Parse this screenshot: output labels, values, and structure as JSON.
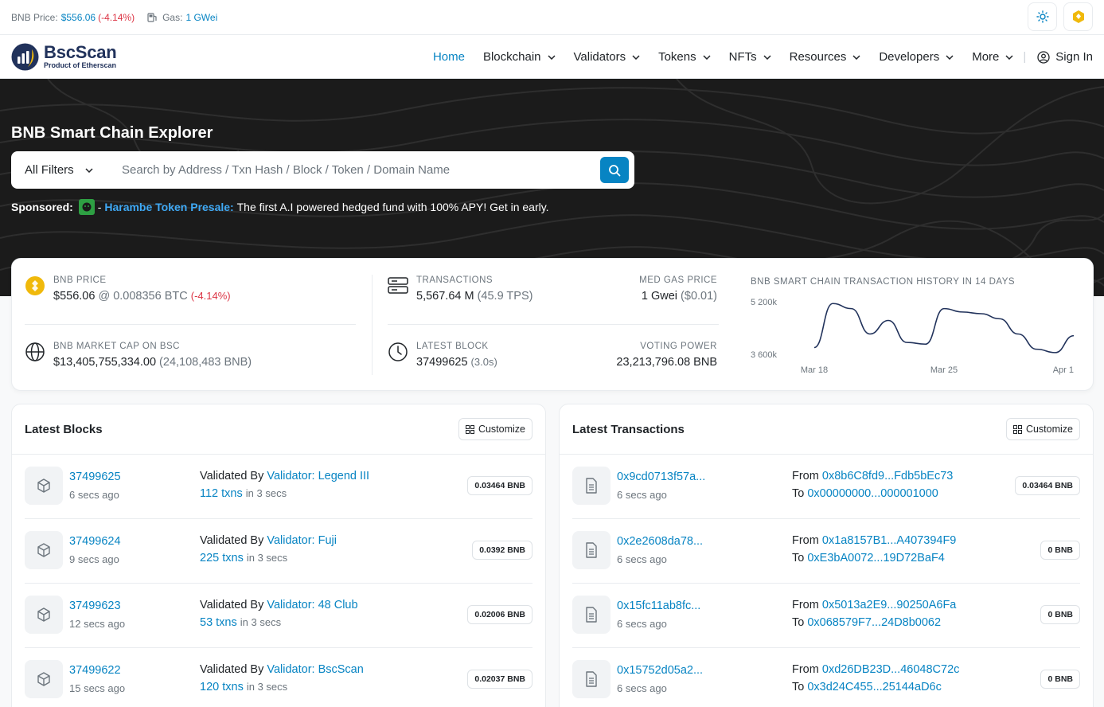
{
  "topbar": {
    "bnb_price_label": "BNB Price:",
    "bnb_price_value": "$556.06",
    "bnb_price_change": "(-4.14%)",
    "gas_label": "Gas:",
    "gas_value": "1 GWei"
  },
  "nav": {
    "logo_title": "BscScan",
    "logo_subtitle": "Product of Etherscan",
    "items": [
      "Home",
      "Blockchain",
      "Validators",
      "Tokens",
      "NFTs",
      "Resources",
      "Developers",
      "More"
    ],
    "signin": "Sign In"
  },
  "hero": {
    "title": "BNB Smart Chain Explorer",
    "filter": "All Filters",
    "search_placeholder": "Search by Address / Txn Hash / Block / Token / Domain Name",
    "sponsored_label": "Sponsored:",
    "sponsored_dash": "-",
    "sponsored_link": "Harambe Token Presale:",
    "sponsored_text": "The first A.I powered hedged fund with 100% APY! Get in early."
  },
  "stats": {
    "bnb_price_label": "BNB PRICE",
    "bnb_price": "$556.06",
    "bnb_price_btc": "@ 0.008356 BTC",
    "bnb_price_change": "(-4.14%)",
    "market_cap_label": "BNB MARKET CAP ON BSC",
    "market_cap": "$13,405,755,334.00",
    "market_cap_bnb": "(24,108,483 BNB)",
    "transactions_label": "TRANSACTIONS",
    "transactions": "5,567.64 M",
    "tps": "(45.9 TPS)",
    "gas_label": "MED GAS PRICE",
    "gas": "1 Gwei",
    "gas_usd": "($0.01)",
    "latest_block_label": "LATEST BLOCK",
    "latest_block": "37499625",
    "block_time": "(3.0s)",
    "voting_power_label": "VOTING POWER",
    "voting_power": "23,213,796.08 BNB"
  },
  "chart_data": {
    "type": "line",
    "title": "BNB SMART CHAIN TRANSACTION HISTORY IN 14 DAYS",
    "x": [
      "Mar 18",
      "Mar 19",
      "Mar 20",
      "Mar 21",
      "Mar 22",
      "Mar 23",
      "Mar 24",
      "Mar 25",
      "Mar 26",
      "Mar 27",
      "Mar 28",
      "Mar 29",
      "Mar 30",
      "Mar 31",
      "Apr 1"
    ],
    "values": [
      3800,
      5100,
      4950,
      4200,
      4600,
      3950,
      3900,
      4950,
      4850,
      4800,
      4650,
      4200,
      3750,
      3650,
      4150
    ],
    "x_tick_labels": [
      "Mar 18",
      "Mar 25",
      "Apr 1"
    ],
    "y_tick_labels": [
      "5 200k",
      "3 600k"
    ],
    "ylim": [
      3600,
      5200
    ]
  },
  "blocks": {
    "title": "Latest Blocks",
    "customize": "Customize",
    "rows": [
      {
        "id": "37499625",
        "time": "6 secs ago",
        "validated_by": "Validated By",
        "validator": "Validator: Legend III",
        "txns": "112 txns",
        "txns_suffix": "in 3 secs",
        "reward": "0.03464 BNB"
      },
      {
        "id": "37499624",
        "time": "9 secs ago",
        "validated_by": "Validated By",
        "validator": "Validator: Fuji",
        "txns": "225 txns",
        "txns_suffix": "in 3 secs",
        "reward": "0.0392 BNB"
      },
      {
        "id": "37499623",
        "time": "12 secs ago",
        "validated_by": "Validated By",
        "validator": "Validator: 48 Club",
        "txns": "53 txns",
        "txns_suffix": "in 3 secs",
        "reward": "0.02006 BNB"
      },
      {
        "id": "37499622",
        "time": "15 secs ago",
        "validated_by": "Validated By",
        "validator": "Validator: BscScan",
        "txns": "120 txns",
        "txns_suffix": "in 3 secs",
        "reward": "0.02037 BNB"
      }
    ]
  },
  "txs": {
    "title": "Latest Transactions",
    "customize": "Customize",
    "rows": [
      {
        "hash": "0x9cd0713f57a...",
        "time": "6 secs ago",
        "from_label": "From",
        "from": "0x8b6C8fd9...Fdb5bEc73",
        "to_label": "To",
        "to": "0x00000000...000001000",
        "value": "0.03464 BNB"
      },
      {
        "hash": "0x2e2608da78...",
        "time": "6 secs ago",
        "from_label": "From",
        "from": "0x1a8157B1...A407394F9",
        "to_label": "To",
        "to": "0xE3bA0072...19D72BaF4",
        "value": "0 BNB"
      },
      {
        "hash": "0x15fc11ab8fc...",
        "time": "6 secs ago",
        "from_label": "From",
        "from": "0x5013a2E9...90250A6Fa",
        "to_label": "To",
        "to": "0x068579F7...24D8b0062",
        "value": "0 BNB"
      },
      {
        "hash": "0x15752d05a2...",
        "time": "6 secs ago",
        "from_label": "From",
        "from": "0xd26DB23D...46048C72c",
        "to_label": "To",
        "to": "0x3d24C455...25144aD6c",
        "value": "0 BNB"
      }
    ]
  },
  "colors": {
    "link": "#0784c3",
    "negative": "#dc3545",
    "hero_bg": "#1b1b1b",
    "bnb_yellow": "#f0b90b"
  }
}
